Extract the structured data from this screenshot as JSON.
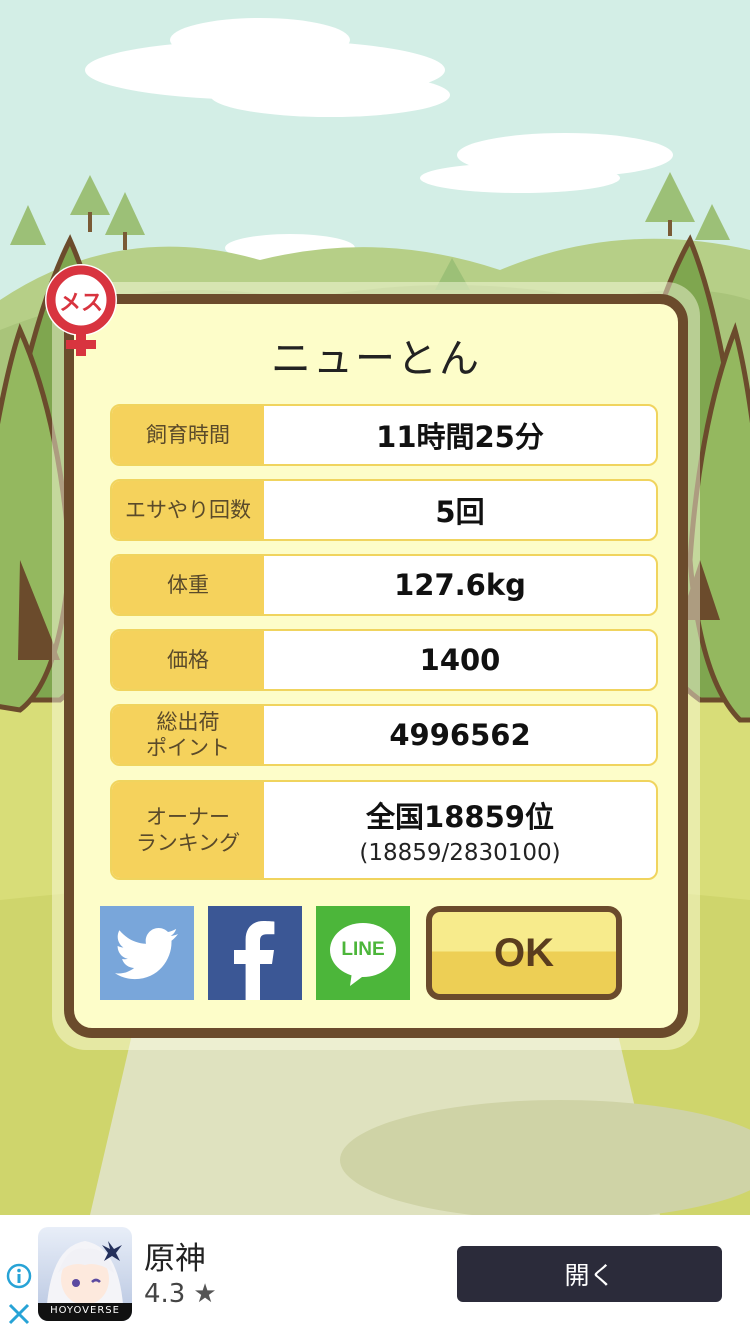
{
  "dialog": {
    "title": "ニューとん",
    "badge_text": "メス",
    "stats": [
      {
        "label": "飼育時間",
        "value": "11時間25分"
      },
      {
        "label": "エサやり回数",
        "value": "5回"
      },
      {
        "label": "体重",
        "value": "127.6kg"
      },
      {
        "label": "価格",
        "value": "1400"
      },
      {
        "label": "総出荷\nポイント",
        "value": "4996562"
      },
      {
        "label": "オーナー\nランキング",
        "value": "全国18859位",
        "sub": "(18859/2830100)"
      }
    ],
    "share": {
      "twitter_icon": "twitter-bird-icon",
      "facebook_icon": "facebook-f-icon",
      "line_label": "LINE"
    },
    "ok_label": "OK"
  },
  "ad": {
    "app_name": "原神",
    "rating": "4.3",
    "star": "★",
    "publisher_tag": "HOYOVERSE",
    "open_label": "開く"
  },
  "colors": {
    "frame": "#6b4b2c",
    "panel": "#fdfdc9",
    "label_bg": "#f5d25c",
    "twitter": "#79a6da",
    "facebook": "#3b5795",
    "line": "#4cb63a"
  }
}
